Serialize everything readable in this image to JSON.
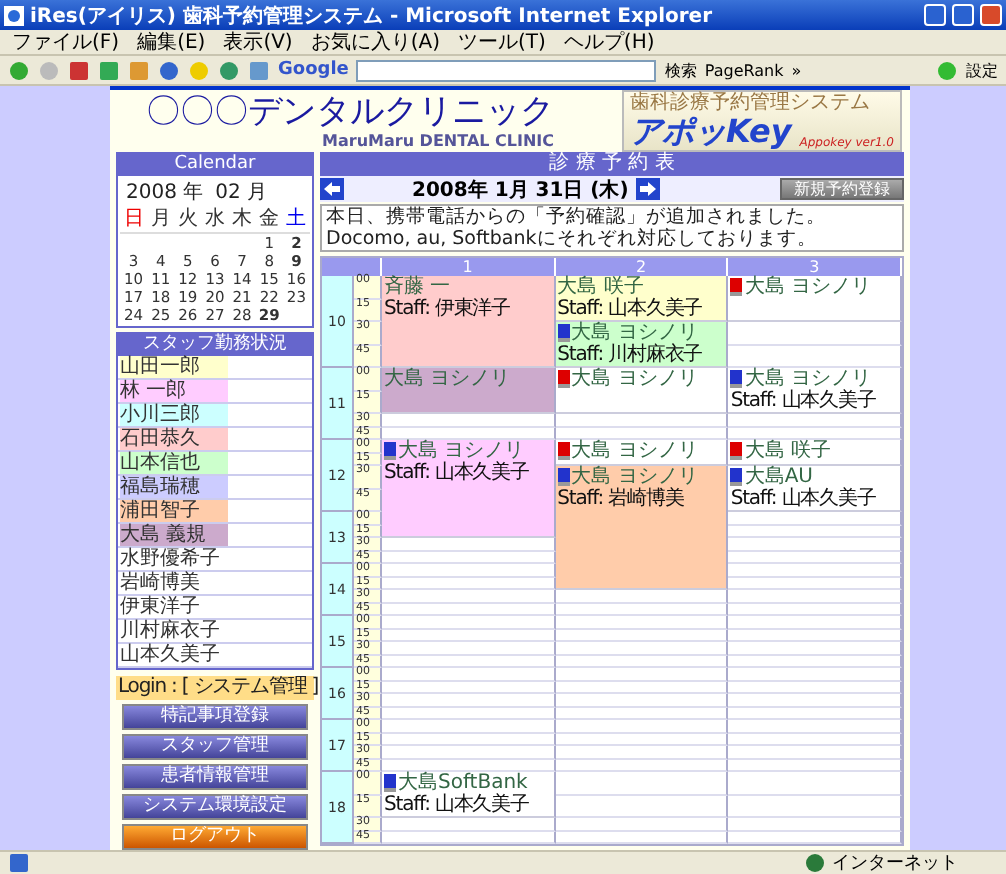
{
  "window": {
    "title": "iRes(アイリス) 歯科予約管理システム - Microsoft Internet Explorer"
  },
  "menu": [
    "ファイル(F)",
    "編集(E)",
    "表示(V)",
    "お気に入り(A)",
    "ツール(T)",
    "ヘルプ(H)"
  ],
  "toolbar": {
    "google": "Google",
    "search_button": "検索",
    "pagerank": "PageRank",
    "more": "»",
    "settings": "設定"
  },
  "header": {
    "clinic_name": "〇〇〇デンタルクリニック",
    "clinic_subtitle": "MaruMaru DENTAL CLINIC",
    "logo": {
      "caption": "歯科診療予約管理システム",
      "version": "Appokey ver1.0",
      "name": "アポッKey"
    }
  },
  "calendar": {
    "title": "Calendar",
    "year": "2008 年",
    "month": "02 月",
    "weekdays": [
      {
        "label": "日",
        "color": "#ee0000"
      },
      {
        "label": "月",
        "color": "#333333"
      },
      {
        "label": "火",
        "color": "#333333"
      },
      {
        "label": "水",
        "color": "#333333"
      },
      {
        "label": "木",
        "color": "#333333"
      },
      {
        "label": "金",
        "color": "#333333"
      },
      {
        "label": "土",
        "color": "#0000ee"
      }
    ],
    "weeks": [
      [
        {
          "day": "1",
          "bold": false
        },
        {
          "day": "2",
          "bold": true
        }
      ],
      [
        {
          "day": "3",
          "bold": false
        },
        {
          "day": "4",
          "bold": false
        },
        {
          "day": "5",
          "bold": false
        },
        {
          "day": "6",
          "bold": false
        },
        {
          "day": "7",
          "bold": false
        },
        {
          "day": "8",
          "bold": false
        },
        {
          "day": "9",
          "bold": true
        }
      ],
      [
        {
          "day": "10",
          "bold": false
        },
        {
          "day": "11",
          "bold": false
        },
        {
          "day": "12",
          "bold": false
        },
        {
          "day": "13",
          "bold": false
        },
        {
          "day": "14",
          "bold": false
        },
        {
          "day": "15",
          "bold": false
        },
        {
          "day": "16",
          "bold": false
        }
      ],
      [
        {
          "day": "17",
          "bold": false
        },
        {
          "day": "18",
          "bold": false
        },
        {
          "day": "19",
          "bold": false
        },
        {
          "day": "20",
          "bold": false
        },
        {
          "day": "21",
          "bold": false
        },
        {
          "day": "22",
          "bold": false
        },
        {
          "day": "23",
          "bold": false
        }
      ],
      [
        {
          "day": "24",
          "bold": false
        },
        {
          "day": "25",
          "bold": false
        },
        {
          "day": "26",
          "bold": false
        },
        {
          "day": "27",
          "bold": false
        },
        {
          "day": "28",
          "bold": false
        },
        {
          "day": "29",
          "bold": true
        }
      ]
    ]
  },
  "staff": {
    "title": "スタッフ勤務状況",
    "items": [
      {
        "name": "山田一郎",
        "color": "#ffffcc"
      },
      {
        "name": "林 一郎",
        "color": "#ffccff"
      },
      {
        "name": "小川三郎",
        "color": "#ccffff"
      },
      {
        "name": "石田恭久",
        "color": "#ffcccc"
      },
      {
        "name": "山本信也",
        "color": "#ccffcc"
      },
      {
        "name": "福島瑞穂",
        "color": "#ccccff"
      },
      {
        "name": "浦田智子",
        "color": "#ffccaa"
      },
      {
        "name": "大島 義規",
        "color": "#ccaacc"
      },
      {
        "name": "水野優希子",
        "color": "#ffffff"
      },
      {
        "name": "岩崎博美",
        "color": "#ffffff"
      },
      {
        "name": "伊東洋子",
        "color": "#ffffff"
      },
      {
        "name": "川村麻衣子",
        "color": "#ffffff"
      },
      {
        "name": "山本久美子",
        "color": "#ffffff"
      }
    ]
  },
  "login": "Login : [ システム管理 ]",
  "buttons": [
    {
      "label": "特記事項登録",
      "kind": "normal"
    },
    {
      "label": "スタッフ管理",
      "kind": "normal"
    },
    {
      "label": "患者情報管理",
      "kind": "normal"
    },
    {
      "label": "システム環境設定",
      "kind": "normal"
    },
    {
      "label": "ログアウト",
      "kind": "logout"
    }
  ],
  "schedule": {
    "title": "診 療 予 約 表",
    "date": "2008年 1月 31日 (木)",
    "new_button": "新規予約登録",
    "notice": [
      "本日、携帯電話からの「予約確認」が追加されました。",
      "Docomo, au, Softbankにそれぞれ対応しております。"
    ],
    "columns": [
      "1",
      "2",
      "3"
    ],
    "hours": [
      {
        "hour": "10",
        "slots": [
          {
            "minute": "00",
            "cells": [
              {
                "kind": "appointment",
                "name": "斉藤 一",
                "staff": "Staff: 伊東洋子",
                "color": "#ffcccc"
              },
              {
                "kind": "appointment",
                "name": "大島 咲子",
                "staff": "Staff: 山本久美子",
                "color": "#ffffcc"
              },
              {
                "kind": "appointment",
                "name": "大島 ヨシノリ",
                "color": "#ffffff",
                "phone": {
                  "color": "#dd0000"
                }
              }
            ]
          },
          {
            "minute": "15",
            "cells": [
              {
                "kind": "continued"
              },
              {
                "kind": "continued"
              },
              {
                "kind": "continued"
              }
            ]
          },
          {
            "minute": "30",
            "cells": [
              {
                "kind": "continued"
              },
              {
                "kind": "appointment",
                "name": "大島 ヨシノリ",
                "staff": "Staff: 川村麻衣子",
                "color": "#ccffcc",
                "phone": {
                  "color": "#2233cc"
                }
              },
              {
                "kind": "empty"
              }
            ]
          },
          {
            "minute": "45",
            "cells": [
              {
                "kind": "continued"
              },
              {
                "kind": "continued"
              },
              {
                "kind": "empty"
              }
            ]
          }
        ]
      },
      {
        "hour": "11",
        "slots": [
          {
            "minute": "00",
            "cells": [
              {
                "kind": "appointment",
                "name": "大島 ヨシノリ",
                "color": "#ccaacc"
              },
              {
                "kind": "appointment",
                "name": "大島 ヨシノリ",
                "color": "#ffffff",
                "phone": {
                  "color": "#dd0000"
                }
              },
              {
                "kind": "appointment",
                "name": "大島 ヨシノリ",
                "staff": "Staff: 山本久美子",
                "color": "#ffffff",
                "phone": {
                  "color": "#2233cc"
                }
              }
            ]
          },
          {
            "minute": "15",
            "cells": [
              {
                "kind": "continued"
              },
              {
                "kind": "continued"
              },
              {
                "kind": "continued"
              }
            ]
          },
          {
            "minute": "30",
            "cells": [
              {
                "kind": "empty"
              },
              {
                "kind": "empty"
              },
              {
                "kind": "empty"
              }
            ]
          },
          {
            "minute": "45",
            "cells": [
              {
                "kind": "empty"
              },
              {
                "kind": "empty"
              },
              {
                "kind": "empty"
              }
            ]
          }
        ]
      },
      {
        "hour": "12",
        "slots": [
          {
            "minute": "00",
            "cells": [
              {
                "kind": "appointment",
                "name": "大島 ヨシノリ",
                "staff": "Staff: 山本久美子",
                "color": "#ffccff",
                "phone": {
                  "color": "#2233cc"
                }
              },
              {
                "kind": "appointment",
                "name": "大島 ヨシノリ",
                "color": "#ffffff",
                "phone": {
                  "color": "#dd0000"
                }
              },
              {
                "kind": "appointment",
                "name": "大島 咲子",
                "color": "#ffffff",
                "phone": {
                  "color": "#dd0000"
                }
              }
            ]
          },
          {
            "minute": "15",
            "cells": [
              {
                "kind": "continued"
              },
              {
                "kind": "continued"
              },
              {
                "kind": "continued"
              }
            ]
          },
          {
            "minute": "30",
            "cells": [
              {
                "kind": "continued"
              },
              {
                "kind": "appointment",
                "name": "大島 ヨシノリ",
                "staff": "Staff: 岩崎博美",
                "color": "#ffccaa",
                "phone": {
                  "color": "#2233cc"
                }
              },
              {
                "kind": "appointment",
                "name": "大島AU",
                "staff": "Staff: 山本久美子",
                "color": "#ffffff",
                "phone": {
                  "color": "#2233cc"
                }
              }
            ]
          },
          {
            "minute": "45",
            "cells": [
              {
                "kind": "continued"
              },
              {
                "kind": "continued"
              },
              {
                "kind": "continued"
              }
            ]
          }
        ]
      },
      {
        "hour": "13",
        "slots": [
          {
            "minute": "00",
            "cells": [
              {
                "kind": "continued"
              },
              {
                "kind": "continued"
              },
              {
                "kind": "empty"
              }
            ]
          },
          {
            "minute": "15",
            "cells": [
              {
                "kind": "continued"
              },
              {
                "kind": "continued"
              },
              {
                "kind": "empty"
              }
            ]
          },
          {
            "minute": "30",
            "cells": [
              {
                "kind": "empty"
              },
              {
                "kind": "continued"
              },
              {
                "kind": "empty"
              }
            ]
          },
          {
            "minute": "45",
            "cells": [
              {
                "kind": "empty"
              },
              {
                "kind": "continued"
              },
              {
                "kind": "empty"
              }
            ]
          }
        ]
      },
      {
        "hour": "14",
        "slots": [
          {
            "minute": "00",
            "cells": [
              {
                "kind": "empty"
              },
              {
                "kind": "continued"
              },
              {
                "kind": "empty"
              }
            ]
          },
          {
            "minute": "15",
            "cells": [
              {
                "kind": "empty"
              },
              {
                "kind": "continued"
              },
              {
                "kind": "empty"
              }
            ]
          },
          {
            "minute": "30",
            "cells": [
              {
                "kind": "empty"
              },
              {
                "kind": "empty"
              },
              {
                "kind": "empty"
              }
            ]
          },
          {
            "minute": "45",
            "cells": [
              {
                "kind": "empty"
              },
              {
                "kind": "empty"
              },
              {
                "kind": "empty"
              }
            ]
          }
        ]
      },
      {
        "hour": "15",
        "slots": [
          {
            "minute": "00",
            "cells": [
              {
                "kind": "empty"
              },
              {
                "kind": "empty"
              },
              {
                "kind": "empty"
              }
            ]
          },
          {
            "minute": "15",
            "cells": [
              {
                "kind": "empty"
              },
              {
                "kind": "empty"
              },
              {
                "kind": "empty"
              }
            ]
          },
          {
            "minute": "30",
            "cells": [
              {
                "kind": "empty"
              },
              {
                "kind": "empty"
              },
              {
                "kind": "empty"
              }
            ]
          },
          {
            "minute": "45",
            "cells": [
              {
                "kind": "empty"
              },
              {
                "kind": "empty"
              },
              {
                "kind": "empty"
              }
            ]
          }
        ]
      },
      {
        "hour": "16",
        "slots": [
          {
            "minute": "00",
            "cells": [
              {
                "kind": "empty"
              },
              {
                "kind": "empty"
              },
              {
                "kind": "empty"
              }
            ]
          },
          {
            "minute": "15",
            "cells": [
              {
                "kind": "empty"
              },
              {
                "kind": "empty"
              },
              {
                "kind": "empty"
              }
            ]
          },
          {
            "minute": "30",
            "cells": [
              {
                "kind": "empty"
              },
              {
                "kind": "empty"
              },
              {
                "kind": "empty"
              }
            ]
          },
          {
            "minute": "45",
            "cells": [
              {
                "kind": "empty"
              },
              {
                "kind": "empty"
              },
              {
                "kind": "empty"
              }
            ]
          }
        ]
      },
      {
        "hour": "17",
        "slots": [
          {
            "minute": "00",
            "cells": [
              {
                "kind": "empty"
              },
              {
                "kind": "empty"
              },
              {
                "kind": "empty"
              }
            ]
          },
          {
            "minute": "15",
            "cells": [
              {
                "kind": "empty"
              },
              {
                "kind": "empty"
              },
              {
                "kind": "empty"
              }
            ]
          },
          {
            "minute": "30",
            "cells": [
              {
                "kind": "empty"
              },
              {
                "kind": "empty"
              },
              {
                "kind": "empty"
              }
            ]
          },
          {
            "minute": "45",
            "cells": [
              {
                "kind": "empty"
              },
              {
                "kind": "empty"
              },
              {
                "kind": "empty"
              }
            ]
          }
        ]
      },
      {
        "hour": "18",
        "slots": [
          {
            "minute": "00",
            "cells": [
              {
                "kind": "appointment",
                "name": "大島SoftBank",
                "staff": "Staff: 山本久美子",
                "color": "#ffffff",
                "phone": {
                  "color": "#2233cc"
                }
              },
              {
                "kind": "empty"
              },
              {
                "kind": "empty"
              }
            ]
          },
          {
            "minute": "15",
            "cells": [
              {
                "kind": "continued"
              },
              {
                "kind": "empty"
              },
              {
                "kind": "empty"
              }
            ]
          },
          {
            "minute": "30",
            "cells": [
              {
                "kind": "empty"
              },
              {
                "kind": "empty"
              },
              {
                "kind": "empty"
              }
            ]
          },
          {
            "minute": "45",
            "cells": [
              {
                "kind": "empty"
              },
              {
                "kind": "empty"
              },
              {
                "kind": "empty"
              }
            ]
          }
        ]
      }
    ]
  },
  "status_bar": {
    "zone": "インターネット"
  }
}
